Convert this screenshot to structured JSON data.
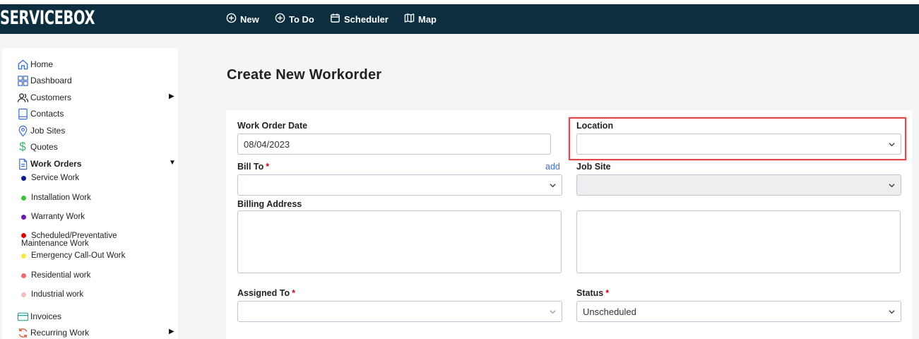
{
  "header": {
    "logo": "SERVICEBOX",
    "nav": [
      {
        "label": "New",
        "icon": "plus-circle-icon"
      },
      {
        "label": "To Do",
        "icon": "plus-circle-icon"
      },
      {
        "label": "Scheduler",
        "icon": "calendar-icon"
      },
      {
        "label": "Map",
        "icon": "map-icon"
      }
    ]
  },
  "sidebar": {
    "items": [
      {
        "label": "Home",
        "icon": "home-icon"
      },
      {
        "label": "Dashboard",
        "icon": "dashboard-icon"
      },
      {
        "label": "Customers",
        "icon": "users-icon"
      },
      {
        "label": "Contacts",
        "icon": "book-icon"
      },
      {
        "label": "Job Sites",
        "icon": "location-pin-icon"
      },
      {
        "label": "Quotes",
        "icon": "dollar-icon"
      },
      {
        "label": "Work Orders",
        "icon": "document-icon"
      },
      {
        "label": "Invoices",
        "icon": "credit-card-icon"
      },
      {
        "label": "Recurring Work",
        "icon": "refresh-icon"
      }
    ],
    "work_order_types": [
      {
        "label": "Service Work",
        "color": "#0a1a8a"
      },
      {
        "label": "Installation Work",
        "color": "#3cc13b"
      },
      {
        "label": "Warranty Work",
        "color": "#6a1bb0"
      },
      {
        "label": "Scheduled/Preventative Maintenance Work",
        "color": "#e00000"
      },
      {
        "label": "Emergency Call-Out Work",
        "color": "#f5e64a"
      },
      {
        "label": "Residential work",
        "color": "#ef6b6b"
      },
      {
        "label": "Industrial work",
        "color": "#f4bcbc"
      }
    ]
  },
  "form": {
    "title": "Create New Workorder",
    "work_order_date_label": "Work Order Date",
    "work_order_date_value": "08/04/2023",
    "location_label": "Location",
    "location_value": "",
    "bill_to_label": "Bill To",
    "bill_to_add": "add",
    "bill_to_value": "",
    "job_site_label": "Job Site",
    "job_site_value": "",
    "billing_address_label": "Billing Address",
    "assigned_to_label": "Assigned To",
    "assigned_to_value": "",
    "status_label": "Status",
    "status_value": "Unscheduled",
    "required_mark": "*"
  },
  "colors": {
    "topbar": "#0d2e3f",
    "highlight": "#e24848",
    "link": "#3b6fd6"
  }
}
